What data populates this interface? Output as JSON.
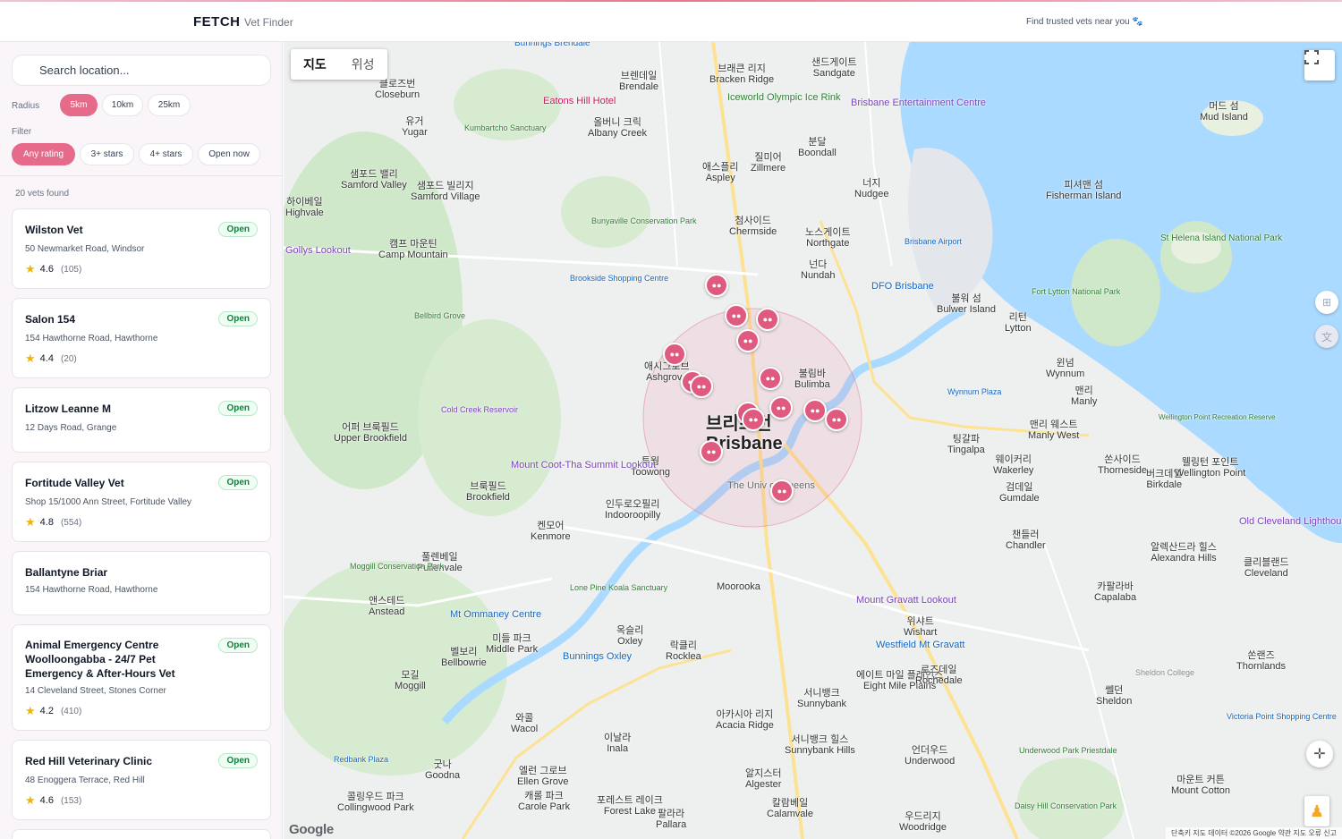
{
  "header": {
    "brand": "FETCH",
    "subtitle": "Vet Finder",
    "tagline": "Find trusted vets near you 🐾"
  },
  "sidebar": {
    "search_placeholder": "Search location...",
    "radius_label": "Radius",
    "radius_options": [
      "5km",
      "10km",
      "25km"
    ],
    "radius_selected": "5km",
    "filter_label": "Filter",
    "filter_options": [
      "Any rating",
      "3+ stars",
      "4+ stars",
      "Open now"
    ],
    "filter_selected": "Any rating",
    "results_count": "20 vets found",
    "vets": [
      {
        "name": "Wilston Vet",
        "address": "50 Newmarket Road, Windsor",
        "rating": "4.6",
        "reviews": "(105)",
        "status": "Open"
      },
      {
        "name": "Salon 154",
        "address": "154 Hawthorne Road, Hawthorne",
        "rating": "4.4",
        "reviews": "(20)",
        "status": "Open"
      },
      {
        "name": "Litzow Leanne M",
        "address": "12 Days Road, Grange",
        "rating": "",
        "reviews": "",
        "status": "Open"
      },
      {
        "name": "Fortitude Valley Vet",
        "address": "Shop 15/1000 Ann Street, Fortitude Valley",
        "rating": "4.8",
        "reviews": "(554)",
        "status": "Open"
      },
      {
        "name": "Ballantyne Briar",
        "address": "154 Hawthorne Road, Hawthorne",
        "rating": "",
        "reviews": "",
        "status": ""
      },
      {
        "name": "Animal Emergency Centre Woolloongabba - 24/7 Pet Emergency & After-Hours Vet",
        "address": "14 Cleveland Street, Stones Corner",
        "rating": "4.2",
        "reviews": "(410)",
        "status": "Open"
      },
      {
        "name": "Red Hill Veterinary Clinic",
        "address": "48 Enoggera Terrace, Red Hill",
        "rating": "4.6",
        "reviews": "(153)",
        "status": "Open"
      }
    ]
  },
  "map": {
    "map_type_options": [
      "지도",
      "위성"
    ],
    "map_type_selected": "지도",
    "city_label_ko": "브리즈번",
    "city_label_en": "Brisbane",
    "logo": "Google",
    "attribution": "단축키   지도 데이터 ©2026 Google   약관   지도 오류 신고",
    "marker_icon": "paw-icon",
    "labels": [
      {
        "ko": "브렌데일",
        "en": "Brendale"
      },
      {
        "ko": "브래큰 리지",
        "en": "Bracken Ridge"
      },
      {
        "ko": "샌드게이트",
        "en": "Sandgate"
      },
      {
        "ko": "클로즈번",
        "en": "Closeburn"
      },
      {
        "ko": "유거",
        "en": "Yugar"
      },
      {
        "ko": "올버니 크릭",
        "en": "Albany Creek"
      },
      {
        "ko": "애스플리",
        "en": "Aspley"
      },
      {
        "ko": "질미어",
        "en": "Zillmere"
      },
      {
        "ko": "분달",
        "en": "Boondall"
      },
      {
        "ko": "너지",
        "en": "Nudgee"
      },
      {
        "ko": "피셔맨 섬",
        "en": "Fisherman Island"
      },
      {
        "ko": "머드 섬",
        "en": "Mud Island"
      },
      {
        "ko": "샘포드 밸리",
        "en": "Samford Valley"
      },
      {
        "ko": "샘포드 빌리지",
        "en": "Samford Village"
      },
      {
        "ko": "하이베일",
        "en": "Highvale"
      },
      {
        "ko": "첨사이드",
        "en": "Chermside"
      },
      {
        "ko": "노스게이트",
        "en": "Northgate"
      },
      {
        "ko": "캠프 마운틴",
        "en": "Camp Mountain"
      },
      {
        "ko": "넌다",
        "en": "Nundah"
      },
      {
        "ko": "불워 섬",
        "en": "Bulwer Island"
      },
      {
        "ko": "리턴",
        "en": "Lytton"
      },
      {
        "ko": "애시그로브",
        "en": "Ashgrove"
      },
      {
        "ko": "불림바",
        "en": "Bulimba"
      },
      {
        "ko": "윈넘",
        "en": "Wynnum"
      },
      {
        "ko": "맨리",
        "en": "Manly"
      },
      {
        "ko": "어퍼 브룩필드",
        "en": "Upper Brookfield"
      },
      {
        "ko": "투웡",
        "en": "Toowong"
      },
      {
        "ko": "팅갈파",
        "en": "Tingalpa"
      },
      {
        "ko": "웨이커리",
        "en": "Wakerley"
      },
      {
        "ko": "맨리 웨스트",
        "en": "Manly West"
      },
      {
        "ko": "쏜사이드",
        "en": "Thorneside"
      },
      {
        "ko": "버크데일",
        "en": "Birkdale"
      },
      {
        "ko": "웰링턴 포인트",
        "en": "Wellington Point"
      },
      {
        "ko": "브룩필드",
        "en": "Brookfield"
      },
      {
        "ko": "인두로오필리",
        "en": "Indooroopilly"
      },
      {
        "ko": "검데일",
        "en": "Gumdale"
      },
      {
        "ko": "켄모어",
        "en": "Kenmore"
      },
      {
        "ko": "챈들러",
        "en": "Chandler"
      },
      {
        "ko": "풀렌베일",
        "en": "Pullenvale"
      },
      {
        "ko": "알렉산드라 힐스",
        "en": "Alexandra Hills"
      },
      {
        "ko": "클리블랜드",
        "en": "Cleveland"
      },
      {
        "ko": "앤스테드",
        "en": "Anstead"
      },
      {
        "ko": "",
        "en": "Moorooka"
      },
      {
        "ko": "카팔라바",
        "en": "Capalaba"
      },
      {
        "ko": "옥슬리",
        "en": "Oxley"
      },
      {
        "ko": "벨보리",
        "en": "Bellbowrie"
      },
      {
        "ko": "미들 파크",
        "en": "Middle Park"
      },
      {
        "ko": "락클리",
        "en": "Rocklea"
      },
      {
        "ko": "위샤트",
        "en": "Wishart"
      },
      {
        "ko": "모길",
        "en": "Moggill"
      },
      {
        "ko": "에이트 마일 플레인스",
        "en": "Eight Mile Plains"
      },
      {
        "ko": "로즈데일",
        "en": "Rochedale"
      },
      {
        "ko": "서니뱅크",
        "en": "Sunnybank"
      },
      {
        "ko": "와콜",
        "en": "Wacol"
      },
      {
        "ko": "이날라",
        "en": "Inala"
      },
      {
        "ko": "아카시아 리지",
        "en": "Acacia Ridge"
      },
      {
        "ko": "서니뱅크 힐스",
        "en": "Sunnybank Hills"
      },
      {
        "ko": "언더우드",
        "en": "Underwood"
      },
      {
        "ko": "쎌던",
        "en": "Sheldon"
      },
      {
        "ko": "쏜랜즈",
        "en": "Thornlands"
      },
      {
        "ko": "굿나",
        "en": "Goodna"
      },
      {
        "ko": "엘런 그로브",
        "en": "Ellen Grove"
      },
      {
        "ko": "캐롤 파크",
        "en": "Carole Park"
      },
      {
        "ko": "포레스트 레이크",
        "en": "Forest Lake"
      },
      {
        "ko": "알지스터",
        "en": "Algester"
      },
      {
        "ko": "칼람베일",
        "en": "Calamvale"
      },
      {
        "ko": "마운트 커튼",
        "en": "Mount Cotton"
      },
      {
        "ko": "콜링우드 파크",
        "en": "Collingwood Park"
      },
      {
        "ko": "팔라라",
        "en": "Pallara"
      },
      {
        "ko": "우드리지",
        "en": "Woodridge"
      },
      {
        "ko": "더 유니 오브 퀸즈",
        "en": "The Univ of Queens"
      }
    ],
    "pois": [
      {
        "name": "Eatons Hill Hotel",
        "type": "poi"
      },
      {
        "name": "Bunnings Brendale",
        "type": "shop"
      },
      {
        "name": "Kumbartcho Sanctuary",
        "type": "park"
      },
      {
        "name": "Iceworld Olympic Ice Rink",
        "type": "park"
      },
      {
        "name": "Brisbane Entertainment Centre",
        "type": "poi"
      },
      {
        "name": "Bunyaville Conservation Park",
        "type": "park"
      },
      {
        "name": "Brookside Shopping Centre",
        "type": "shop"
      },
      {
        "name": "DFO Brisbane",
        "type": "shop"
      },
      {
        "name": "Brisbane Airport",
        "type": "shop"
      },
      {
        "name": "Fort Lytton National Park",
        "type": "park"
      },
      {
        "name": "St Helena Island National Park",
        "type": "park"
      },
      {
        "name": "Bellbird Grove",
        "type": "park"
      },
      {
        "name": "Gollys Lookout",
        "type": "poi"
      },
      {
        "name": "Cold Creek Reservoir",
        "type": "poi"
      },
      {
        "name": "Wynnum Plaza",
        "type": "shop"
      },
      {
        "name": "Wellington Point Recreation Reserve",
        "type": "park"
      },
      {
        "name": "Mount Coot-Tha Summit Lookout",
        "type": "poi"
      },
      {
        "name": "Moggill Conservation Park",
        "type": "park"
      },
      {
        "name": "Lone Pine Koala Sanctuary",
        "type": "park"
      },
      {
        "name": "Old Cleveland Lighthouse",
        "type": "poi"
      },
      {
        "name": "Mount Gravatt Lookout",
        "type": "poi"
      },
      {
        "name": "Mt Ommaney Centre",
        "type": "shop"
      },
      {
        "name": "Westfield Mt Gravatt",
        "type": "shop"
      },
      {
        "name": "Bunnings Oxley",
        "type": "shop"
      },
      {
        "name": "Sheldon College",
        "type": "poi"
      },
      {
        "name": "Victoria Point Shopping Centre",
        "type": "shop"
      },
      {
        "name": "Redbank Plaza",
        "type": "shop"
      },
      {
        "name": "Underwood Park Priestdale",
        "type": "park"
      },
      {
        "name": "Daisy Hill Conservation Park",
        "type": "park"
      }
    ]
  },
  "colors": {
    "accent": "#e66b8a",
    "marker": "#e05a80",
    "open_badge": "#15803d",
    "water": "#aadaff",
    "park": "#cfe8c9"
  }
}
